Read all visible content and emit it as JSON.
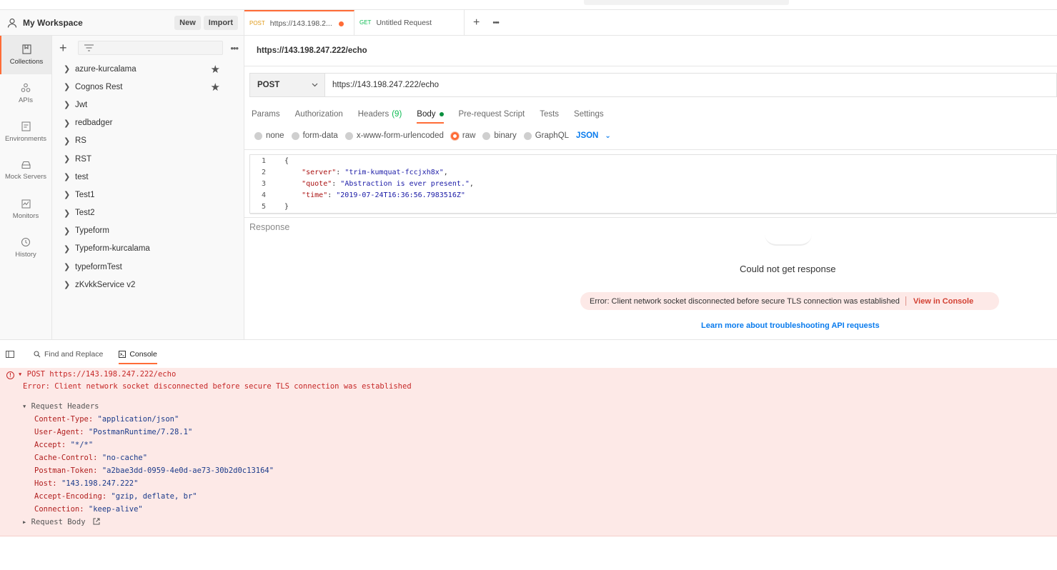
{
  "workspace": {
    "title": "My Workspace",
    "new_label": "New",
    "import_label": "Import"
  },
  "rail": {
    "items": [
      {
        "label": "Collections",
        "icon": "collections-icon",
        "active": true
      },
      {
        "label": "APIs",
        "icon": "apis-icon"
      },
      {
        "label": "Environments",
        "icon": "environments-icon"
      },
      {
        "label": "Mock Servers",
        "icon": "mock-servers-icon"
      },
      {
        "label": "Monitors",
        "icon": "monitors-icon"
      },
      {
        "label": "History",
        "icon": "history-icon"
      }
    ]
  },
  "collections": {
    "items": [
      {
        "name": "azure-kurcalama",
        "starred": true
      },
      {
        "name": "Cognos Rest",
        "starred": true
      },
      {
        "name": "Jwt"
      },
      {
        "name": "redbadger"
      },
      {
        "name": "RS"
      },
      {
        "name": "RST"
      },
      {
        "name": "test"
      },
      {
        "name": "Test1"
      },
      {
        "name": "Test2"
      },
      {
        "name": "Typeform"
      },
      {
        "name": "Typeform-kurcalama"
      },
      {
        "name": "typeformTest"
      },
      {
        "name": "zKvkkService v2"
      }
    ]
  },
  "tabs": [
    {
      "method": "POST",
      "title": "https://143.198.2...",
      "unsaved": true,
      "active": true
    },
    {
      "method": "GET",
      "title": "Untitled Request"
    }
  ],
  "request": {
    "name": "https://143.198.247.222/echo",
    "method": "POST",
    "url": "https://143.198.247.222/echo",
    "tabs": {
      "params": "Params",
      "authorization": "Authorization",
      "headers": "Headers",
      "headers_count": "(9)",
      "body": "Body",
      "prerequest": "Pre-request Script",
      "tests": "Tests",
      "settings": "Settings"
    },
    "body_options": {
      "none": "none",
      "form_data": "form-data",
      "urlencoded": "x-www-form-urlencoded",
      "raw": "raw",
      "binary": "binary",
      "graphql": "GraphQL",
      "format": "JSON",
      "selected": "raw"
    },
    "body_lines": {
      "l1": "{",
      "l2_key": "\"server\"",
      "l2_val": "\"trim-kumquat-fccjxh8x\"",
      "l3_key": "\"quote\"",
      "l3_val": "\"Abstraction is ever present.\"",
      "l4_key": "\"time\"",
      "l4_val": "\"2019-07-24T16:36:56.7983516Z\"",
      "l5": "}"
    },
    "line_numbers": [
      "1",
      "2",
      "3",
      "4",
      "5"
    ]
  },
  "response": {
    "label": "Response",
    "message": "Could not get response",
    "error": "Error: Client network socket disconnected before secure TLS connection was established",
    "view_console": "View in Console",
    "learn_more": "Learn more about troubleshooting API requests"
  },
  "console_bar": {
    "find_replace": "Find and Replace",
    "console": "Console"
  },
  "console": {
    "request_line": "POST https://143.198.247.222/echo",
    "error": "Error: Client network socket disconnected before secure TLS connection was established",
    "request_headers_label": "Request Headers",
    "headers": [
      {
        "key": "Content-Type:",
        "value": "\"application/json\""
      },
      {
        "key": "User-Agent:",
        "value": "\"PostmanRuntime/7.28.1\""
      },
      {
        "key": "Accept:",
        "value": "\"*/*\""
      },
      {
        "key": "Cache-Control:",
        "value": "\"no-cache\""
      },
      {
        "key": "Postman-Token:",
        "value": "\"a2bae3dd-0959-4e0d-ae73-30b2d0c13164\""
      },
      {
        "key": "Host:",
        "value": "\"143.198.247.222\""
      },
      {
        "key": "Accept-Encoding:",
        "value": "\"gzip, deflate, br\""
      },
      {
        "key": "Connection:",
        "value": "\"keep-alive\""
      }
    ],
    "request_body_label": "Request Body"
  },
  "colors": {
    "accent": "#ff6c37",
    "link": "#097bed",
    "error_bg": "#fde9e7",
    "error_text": "#c62828"
  }
}
